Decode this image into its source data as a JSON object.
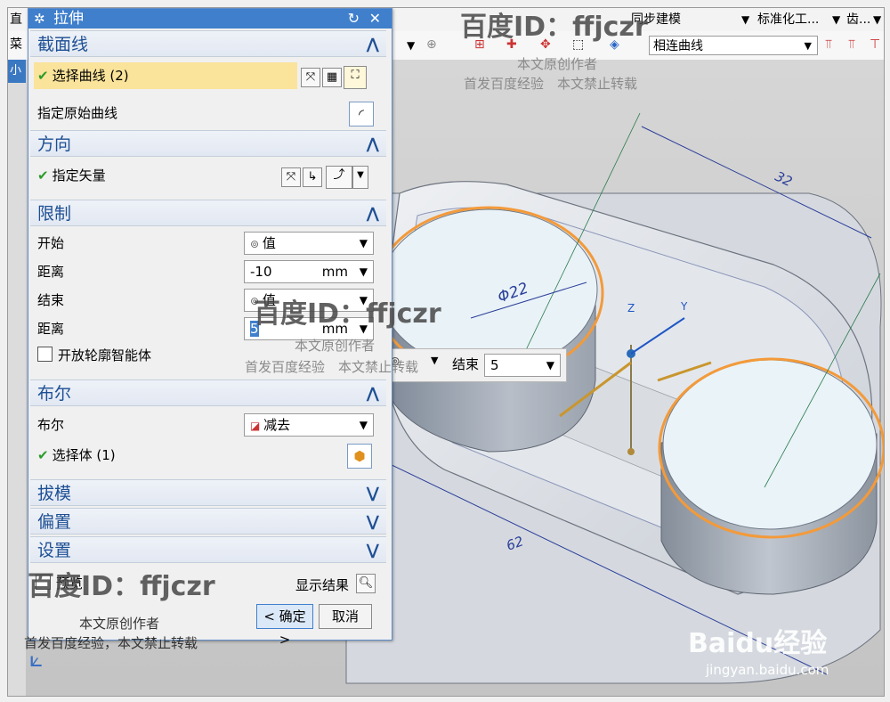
{
  "window": {
    "left_label": "菜",
    "left_label2": "直",
    "side_tab": "小",
    "ribbon_items": [
      "同步建模",
      "标准化工...",
      "齿..."
    ],
    "filter_value": "相连曲线"
  },
  "dialog": {
    "title": "拉伸",
    "sections": {
      "section_curve": {
        "header": "截面线",
        "select_curve": "选择曲线 (2)",
        "specify_original": "指定原始曲线"
      },
      "direction": {
        "header": "方向",
        "specify_vector": "指定矢量"
      },
      "limits": {
        "header": "限制",
        "start_label": "开始",
        "start_value": "值",
        "start_distance_label": "距离",
        "start_distance": "-10",
        "start_unit": "mm",
        "end_label": "结束",
        "end_value": "值",
        "end_distance_label": "距离",
        "end_distance": "5",
        "end_unit": "mm",
        "open_profile": "开放轮廓智能体"
      },
      "boolean": {
        "header": "布尔",
        "bool_label": "布尔",
        "bool_value": "减去",
        "select_body": "选择体 (1)"
      },
      "draft": {
        "header": "拔模"
      },
      "offset": {
        "header": "偏置"
      },
      "settings": {
        "header": "设置"
      }
    },
    "preview_label": "预览",
    "show_result": "显示结果",
    "ok_label": "< 确定 >",
    "cancel_label": "取消"
  },
  "float_input": {
    "end_label": "结束",
    "end_value": "5"
  },
  "viewport": {
    "dim_32": "32",
    "dim_phi22": "Φ22",
    "dim_62": "62",
    "axis_z": "Z",
    "axis_y": "Y"
  },
  "watermarks": {
    "id_text": "百度ID：ffjczr",
    "author": "本文原创作者",
    "notice": "首发百度经验　本文禁止转载",
    "notice2": "首发百度经验，本文禁止转载",
    "baidu": "Baidu经验",
    "site": "jingyan.baidu.com"
  },
  "colors": {
    "accent": "#3f7fcc",
    "section_text": "#1d4f94",
    "highlight": "#fae39a",
    "orange_curve": "#f39a3a",
    "check": "#2a9c2a"
  }
}
